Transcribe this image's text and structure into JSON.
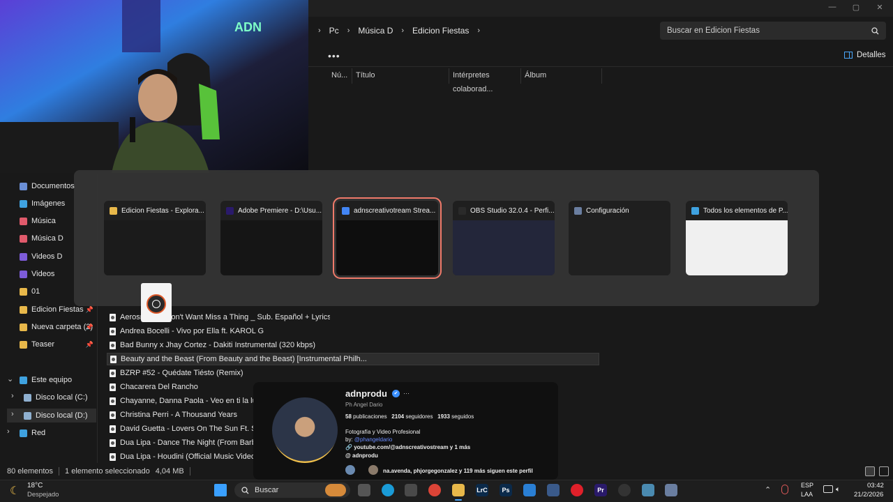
{
  "window": {
    "minimize": "—",
    "maximize": "▢",
    "close": "✕"
  },
  "breadcrumb": [
    "Pc",
    "Música D",
    "Edicion Fiestas"
  ],
  "search": {
    "placeholder": "Buscar en Edicion Fiestas"
  },
  "toolbar": {
    "more": "•••",
    "details_label": "Detalles"
  },
  "columns": [
    "Nú...",
    "Título",
    "Intérpretes colaborad...",
    "Álbum"
  ],
  "sidebar": {
    "items": [
      {
        "label": "Documentos",
        "icon": "documents-icon",
        "color": "#6b8fd6"
      },
      {
        "label": "Imágenes",
        "icon": "images-icon",
        "color": "#3fa2e0"
      },
      {
        "label": "Música",
        "icon": "music-icon",
        "color": "#e05a6b"
      },
      {
        "label": "Música D",
        "icon": "music-icon",
        "color": "#e05a6b"
      },
      {
        "label": "Videos D",
        "icon": "videos-icon",
        "color": "#7d5cd9"
      },
      {
        "label": "Videos",
        "icon": "videos-icon",
        "color": "#7d5cd9"
      },
      {
        "label": "01",
        "icon": "folder-icon",
        "color": "#e8b84a"
      },
      {
        "label": "Edicion Fiestas",
        "icon": "folder-icon",
        "color": "#e8b84a",
        "pinned": true
      },
      {
        "label": "Nueva carpeta (2)",
        "icon": "folder-icon",
        "color": "#e8b84a",
        "pinned": true
      },
      {
        "label": "Teaser",
        "icon": "folder-icon",
        "color": "#e8b84a",
        "pinned": true
      },
      {
        "label": "Este equipo",
        "icon": "computer-icon",
        "color": "#3fa2e0"
      },
      {
        "label": "Disco local (C:)",
        "icon": "drive-icon",
        "color": "#8fb0d0"
      },
      {
        "label": "Disco local (D:)",
        "icon": "drive-icon",
        "color": "#8fb0d0"
      },
      {
        "label": "Red",
        "icon": "network-icon",
        "color": "#3fa2e0"
      }
    ],
    "pin_glyph": "📌",
    "expand_glyph": "›",
    "collapse_glyph": "⌄"
  },
  "files": [
    "Aerosmith - I Don't Want Miss a Thing _ Sub. Español + Lyrics (320 kb...",
    "Andrea Bocelli - Vivo por Ella ft. KAROL G",
    "Bad Bunny x Jhay Cortez - Dakiti Instrumental (320 kbps)",
    "Beauty and the Beast (From Beauty and the Beast) [Instrumental Philh...",
    "BZRP #52 - Quédate Tiésto (Remix)",
    "Chacarera Del Rancho",
    "Chayanne, Danna Paola - Veo en ti la luz (De _E",
    "Christina Perri - A Thousand Years",
    "David Guetta - Lovers On The Sun Ft. Sam Mar",
    "Dua Lipa - Dance The Night (From Barbie The A",
    "Dua Lipa - Houdini (Official Music Video) (320 k"
  ],
  "status": {
    "count": "80 elementos",
    "selected": "1 elemento seleccionado",
    "size": "4,04 MB"
  },
  "switcher": {
    "windows": [
      {
        "title": "Edicion Fiestas - Explora...",
        "icon": "folder-icon",
        "color": "#e8b84a",
        "thumb": "#1b1b1b"
      },
      {
        "title": "Adobe Premiere - D:\\Usu...",
        "icon": "premiere-icon",
        "color": "#2a1a6a",
        "badge": "Pr",
        "thumb": "#151515"
      },
      {
        "title": "adnscreativotream Strea...",
        "icon": "chrome-icon",
        "color": "#4285f4",
        "thumb": "#0e0e0e",
        "selected": true
      },
      {
        "title": "OBS Studio 32.0.4 - Perfi...",
        "icon": "obs-icon",
        "color": "#2a2a2a",
        "thumb": "#23263a"
      },
      {
        "title": "Configuración",
        "icon": "gear-icon",
        "color": "#6a7ea0",
        "thumb": "#202020"
      },
      {
        "title": "Todos los elementos de P...",
        "icon": "control-panel-icon",
        "color": "#3fa2e0",
        "thumb": "#f0f0f0"
      }
    ]
  },
  "profile": {
    "username": "adnprodu",
    "verified": "✔",
    "more": "···",
    "name": "Ph Angel Dario",
    "posts_count": "58",
    "posts_label": "publicaciones",
    "followers_count": "2104",
    "followers_label": "seguidores",
    "following_count": "1933",
    "following_label": "seguidos",
    "bio1": "Fotografía y Video Profesional",
    "bio2_prefix": "by: ",
    "bio2_handle": "@phangeldario",
    "link1": "youtube.com/@adnscreativostream y 1 más",
    "link2": "adnprodu",
    "followed_by": "na.avenda, phjorgegonzalez y 119 más siguen este perfil"
  },
  "taskbar": {
    "weather_temp": "18°C",
    "weather_desc": "Despejado",
    "search_label": "Buscar",
    "lang1": "ESP",
    "lang2": "LAA",
    "time": "03:42",
    "date": "21/2/2026",
    "apps": [
      {
        "name": "windows-start-icon",
        "color": "#3aa0ff",
        "text": ""
      },
      {
        "name": "task-view-icon",
        "color": "#555555",
        "text": ""
      },
      {
        "name": "edge-icon",
        "color": "#1a9bd7",
        "text": ""
      },
      {
        "name": "calculator-icon",
        "color": "#4a4a4a",
        "text": ""
      },
      {
        "name": "chrome-icon",
        "color": "#db4437",
        "text": ""
      },
      {
        "name": "file-explorer-icon",
        "color": "#e8b84a",
        "text": ""
      },
      {
        "name": "lightroom-classic-icon",
        "color": "#0b2a4a",
        "text": "LrC"
      },
      {
        "name": "photoshop-icon",
        "color": "#0b2a4a",
        "text": "Ps"
      },
      {
        "name": "store-icon",
        "color": "#2a7fd4",
        "text": ""
      },
      {
        "name": "app-icon",
        "color": "#3a5a8a",
        "text": ""
      },
      {
        "name": "youtube-music-icon",
        "color": "#e0202a",
        "text": ""
      },
      {
        "name": "premiere-icon",
        "color": "#2a1a6a",
        "text": "Pr"
      },
      {
        "name": "obs-icon",
        "color": "#333333",
        "text": ""
      },
      {
        "name": "monitor-app-icon",
        "color": "#4a8ab0",
        "text": ""
      },
      {
        "name": "settings-icon",
        "color": "#6a7ea0",
        "text": ""
      }
    ]
  }
}
